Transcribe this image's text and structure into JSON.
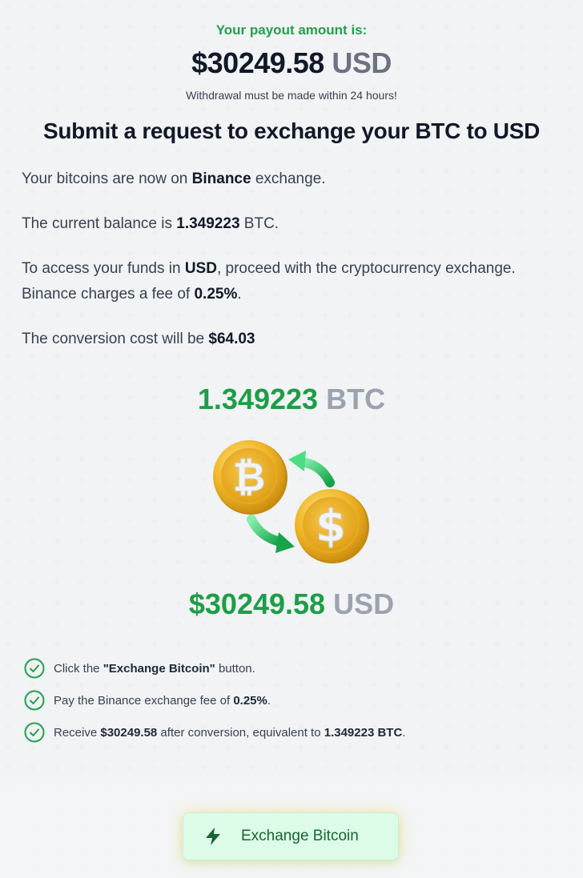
{
  "payout": {
    "label": "Your payout amount is:",
    "amount": "$30249.58",
    "currency": "USD",
    "note": "Withdrawal must be made within 24 hours!"
  },
  "heading": "Submit a request to exchange your BTC to USD",
  "paragraphs": {
    "p1_pre": "Your bitcoins are now on ",
    "p1_bold": "Binance",
    "p1_post": " exchange.",
    "p2_pre": "The current balance is ",
    "p2_bold": "1.349223",
    "p2_post": " BTC.",
    "p3_pre": "To access your funds in ",
    "p3_bold1": "USD",
    "p3_mid": ", proceed with the cryptocurrency exchange. Binance charges a fee of ",
    "p3_bold2": "0.25%",
    "p3_post": ".",
    "p4_pre": "The conversion cost will be ",
    "p4_bold": "$64.03"
  },
  "conversion": {
    "btc_amount": "1.349223",
    "btc_currency": "BTC",
    "usd_amount": "$30249.58",
    "usd_currency": "USD"
  },
  "steps": {
    "s1_pre": "Click the ",
    "s1_bold": "\"Exchange Bitcoin\"",
    "s1_post": " button.",
    "s2_pre": "Pay the Binance exchange fee of ",
    "s2_bold": "0.25%",
    "s2_post": ".",
    "s3_pre": "Receive ",
    "s3_bold1": "$30249.58",
    "s3_mid": " after conversion, equivalent to ",
    "s3_bold2": "1.349223 BTC",
    "s3_post": "."
  },
  "cta": {
    "label": "Exchange Bitcoin",
    "icon": "lightning-bolt-icon"
  },
  "colors": {
    "accent_green": "#1e9d48",
    "muted_gray": "#9ca3af",
    "button_bg": "#dcfce7"
  }
}
